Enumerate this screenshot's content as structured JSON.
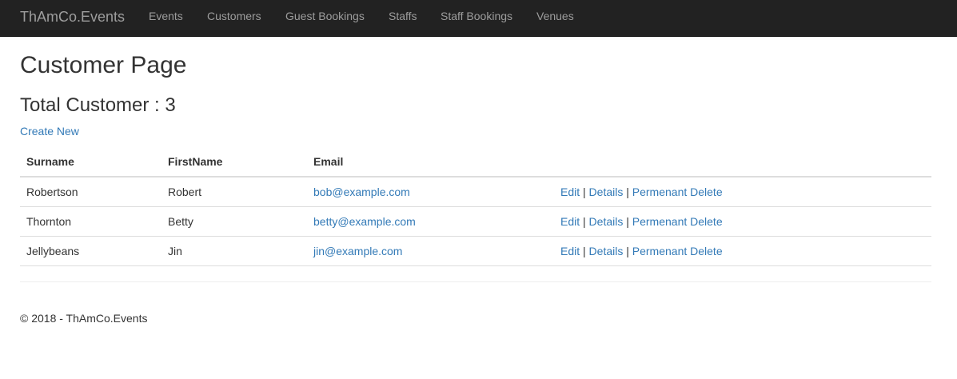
{
  "navbar": {
    "brand": "ThAmCo.Events",
    "links": [
      "Events",
      "Customers",
      "Guest Bookings",
      "Staffs",
      "Staff Bookings",
      "Venues"
    ]
  },
  "main": {
    "title": "Customer Page",
    "count_label": "Total Customer : 3",
    "create_link": "Create New"
  },
  "table": {
    "headers": [
      "Surname",
      "FirstName",
      "Email",
      ""
    ],
    "rows": [
      {
        "surname": "Robertson",
        "firstname": "Robert",
        "email": "bob@example.com"
      },
      {
        "surname": "Thornton",
        "firstname": "Betty",
        "email": "betty@example.com"
      },
      {
        "surname": "Jellybeans",
        "firstname": "Jin",
        "email": "jin@example.com"
      }
    ],
    "actions": {
      "edit": "Edit",
      "details": "Details",
      "delete": "Permenant Delete",
      "separator": "|"
    }
  },
  "footer": {
    "text": "© 2018 - ThAmCo.Events"
  },
  "colors": {
    "navbar_bg": "#222222",
    "nav_text": "#9d9d9d",
    "link": "#337ab7",
    "text": "#333333"
  }
}
